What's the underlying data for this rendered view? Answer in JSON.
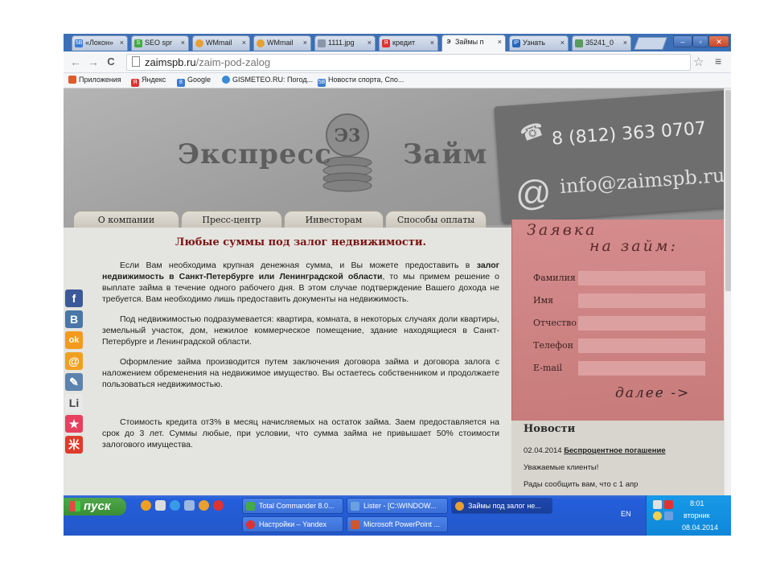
{
  "browser": {
    "tabs": [
      {
        "label": "«Локон»",
        "icon_color": "#3a7bd5",
        "icon_text": "5B"
      },
      {
        "label": "SEO spr",
        "icon_color": "#44aa44",
        "icon_text": "S"
      },
      {
        "label": "WMmail",
        "icon_color": "#e8a030",
        "icon_text": ""
      },
      {
        "label": "WMmail",
        "icon_color": "#e8a030",
        "icon_text": ""
      },
      {
        "label": "1111.jpg",
        "icon_color": "#8a96a8",
        "icon_text": ""
      },
      {
        "label": "кредит",
        "icon_color": "#dd3333",
        "icon_text": "Я"
      },
      {
        "label": "Займы п",
        "icon_color": "#333333",
        "icon_text": "Э"
      },
      {
        "label": "Узнать",
        "icon_color": "#2266bb",
        "icon_text": "IP"
      },
      {
        "label": "35241_0",
        "icon_color": "#5a9a5a",
        "icon_text": ""
      }
    ],
    "tab_close": "×",
    "window_buttons": {
      "minimize": "–",
      "maximize": "▫",
      "close": "✕"
    },
    "nav": {
      "back": "←",
      "forward": "→",
      "reload": "C"
    },
    "url_host": "zaimspb.ru",
    "url_path": "/zaim-pod-zalog",
    "star": "☆",
    "menu": "≡",
    "bookmarks": [
      {
        "label": "Приложения",
        "icon_color": "#e05a2a",
        "icon_text": ""
      },
      {
        "label": "Яндекс",
        "icon_color": "#dd3333",
        "icon_text": "Я"
      },
      {
        "label": "Google",
        "icon_color": "#3a7bd5",
        "icon_text": "8"
      },
      {
        "label": "GISMETEO.RU: Погод...",
        "icon_color": "#3a8ad5",
        "icon_text": ""
      },
      {
        "label": "Новости спорта, Спо...",
        "icon_color": "#3a7bd5",
        "icon_text": "5B"
      }
    ]
  },
  "site": {
    "logo_left": "Экспресс",
    "logo_right": "Займ",
    "coin_mark": "Э3",
    "phone_icon": "☎",
    "phone": "8 (812) 363 0707",
    "at_icon": "@",
    "email": "info@zaimspb.ru",
    "nav": [
      "О компании",
      "Пресс-центр",
      "Инвесторам",
      "Способы оплаты"
    ],
    "heading": "Любые суммы под залог недвижимости.",
    "p1_a": "Если Вам необходима крупная денежная сумма, и Вы можете предоставить в ",
    "p1_b": "залог недвижимость в Санкт-Петербурге или Ленинградской области",
    "p1_c": ", то мы примем решение о выплате займа в течение одного рабочего дня. В этом случае подтверждение Вашего дохода не требуется. Вам необходимо лишь предоставить документы на недвижимость.",
    "p2": "Под недвижимостью подразумевается: квартира, комната, в некоторых случаях доли квартиры, земельный участок, дом, нежилое коммерческое помещение, здание находящиеся в Санкт-Петербурге и Ленинградской области.",
    "p3": "Оформление займа производится путем заключения договора займа и договора залога с наложением обременения на недвижимое имущество. Вы остаетесь собственником и продолжаете пользоваться недвижимостью.",
    "p4": "Стоимость кредита от3% в месяц начисляемых на остаток займа. Заем предоставляется на срок до 3 лет. Суммы любые, при условии, что сумма займа не привышает 50% стоимости залогового имущества.",
    "form": {
      "title_line1": "Заявка",
      "title_line2": "на займ:",
      "fields": [
        "Фамилия",
        "Имя",
        "Отчество",
        "Телефон",
        "E-mail"
      ],
      "submit": "далее ->"
    },
    "news": {
      "title": "Новости",
      "date": "02.04.2014",
      "link": "Беспроцентное погашение",
      "line2": "Уважаемые клиенты!",
      "line3": "Рады сообщить вам, что с 1 апр"
    },
    "social": [
      {
        "name": "facebook-icon",
        "text": "f",
        "color": "#3b5998"
      },
      {
        "name": "vkontakte-icon",
        "text": "В",
        "color": "#4a76a8"
      },
      {
        "name": "odnoklassniki-icon",
        "text": "ok",
        "color": "#f39a1e"
      },
      {
        "name": "mailru-icon",
        "text": "@",
        "color": "#f0a020"
      },
      {
        "name": "livejournal-icon",
        "text": "✎",
        "color": "#5b83ad"
      },
      {
        "name": "liveinternet-icon",
        "text": "Li",
        "color": "#444444"
      },
      {
        "name": "favorites-icon",
        "text": "★",
        "color": "#e5405e"
      },
      {
        "name": "moi-krug-icon",
        "text": "米",
        "color": "#e03a2a"
      }
    ]
  },
  "taskbar": {
    "start": "пуск",
    "tasks_row1": [
      {
        "label": "Total Commander 8.0...",
        "icon_color": "#44aa44"
      },
      {
        "label": "Lister - [C:\\WINDOW...",
        "icon_color": "#6aa0e0"
      },
      {
        "label": "Займы под залог не...",
        "icon_color": "#e8a030"
      }
    ],
    "tasks_row2": [
      {
        "label": "Настройки – Yandex",
        "icon_color": "#dd3333"
      },
      {
        "label": "Microsoft PowerPoint ...",
        "icon_color": "#d2562a"
      }
    ],
    "lang": "EN",
    "time": "8:01",
    "day": "вторник",
    "date": "08.04.2014"
  }
}
